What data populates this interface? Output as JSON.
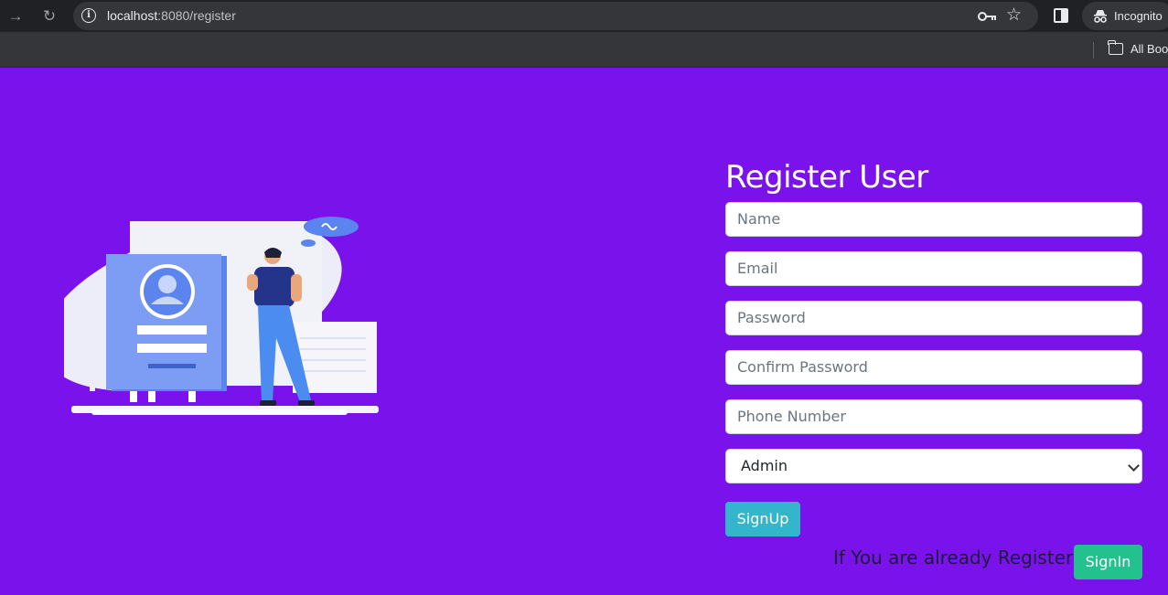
{
  "browser": {
    "url_host": "localhost",
    "url_rest": ":8080/register",
    "incognito_label": "Incognito",
    "bookmarks_label": "All Book"
  },
  "form": {
    "title": "Register User",
    "name_placeholder": "Name",
    "email_placeholder": "Email",
    "password_placeholder": "Password",
    "confirm_password_placeholder": "Confirm Password",
    "phone_placeholder": "Phone Number",
    "role_selected": "Admin",
    "signup_label": "SignUp",
    "already_text": "If You are already Register",
    "signin_label": "SignIn"
  },
  "colors": {
    "page_background": "#7a12ec",
    "signup_button": "#33b6cc",
    "signin_button": "#22c18e"
  }
}
